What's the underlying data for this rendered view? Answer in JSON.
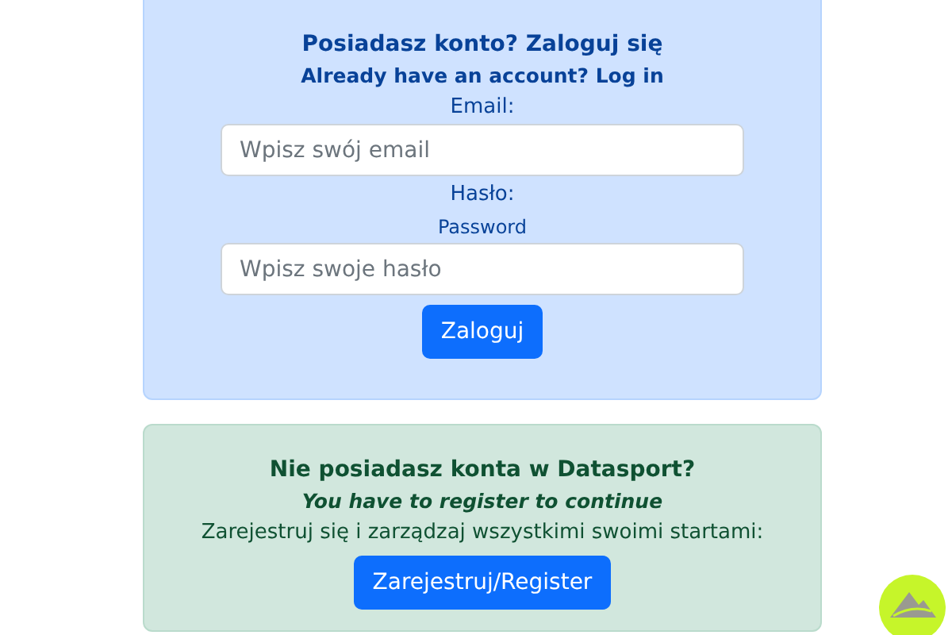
{
  "login_panel": {
    "title": "Posiadasz konto? Zaloguj się",
    "subtitle": "Already have an account? Log in",
    "email_label": "Email:",
    "email_placeholder": "Wpisz swój email",
    "password_label": "Hasło:",
    "password_sublabel": "Password",
    "password_placeholder": "Wpisz swoje hasło",
    "button": "Zaloguj"
  },
  "register_panel": {
    "title": "Nie posiadasz konta w Datasport?",
    "subtitle": "You have to register to continue",
    "text": "Zarejestruj się i zarządzaj wszystkimi swoimi startami:",
    "button": "Zarejestruj/Register"
  }
}
